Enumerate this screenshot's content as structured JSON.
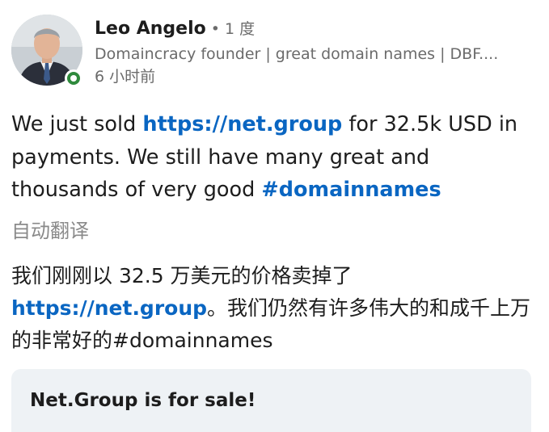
{
  "author": {
    "name": "Leo Angelo",
    "degree": " • 1 度",
    "headline": "Domaincracy founder | great domain names | DBF....",
    "time": "6 小时前",
    "online_color": "#2f8a3c"
  },
  "post": {
    "text_1": "We just sold ",
    "link_1": "https://net.group",
    "text_2": " for 32.5k USD in payments. We still have many great and thousands of very good  ",
    "hashtag": "#domainnames",
    "translate_label": "自动翻译",
    "translated_1": "我们刚刚以 32.5 万美元的价格卖掉了 ",
    "translated_link": "https://net.group",
    "translated_2": "。我们仍然有许多伟大的和成千上万的非常好的#domainnames"
  },
  "preview": {
    "title": "Net.Group is for sale!"
  },
  "colors": {
    "link": "#0a66c2",
    "muted": "#6b6b6b",
    "card_bg": "#eef2f5"
  }
}
